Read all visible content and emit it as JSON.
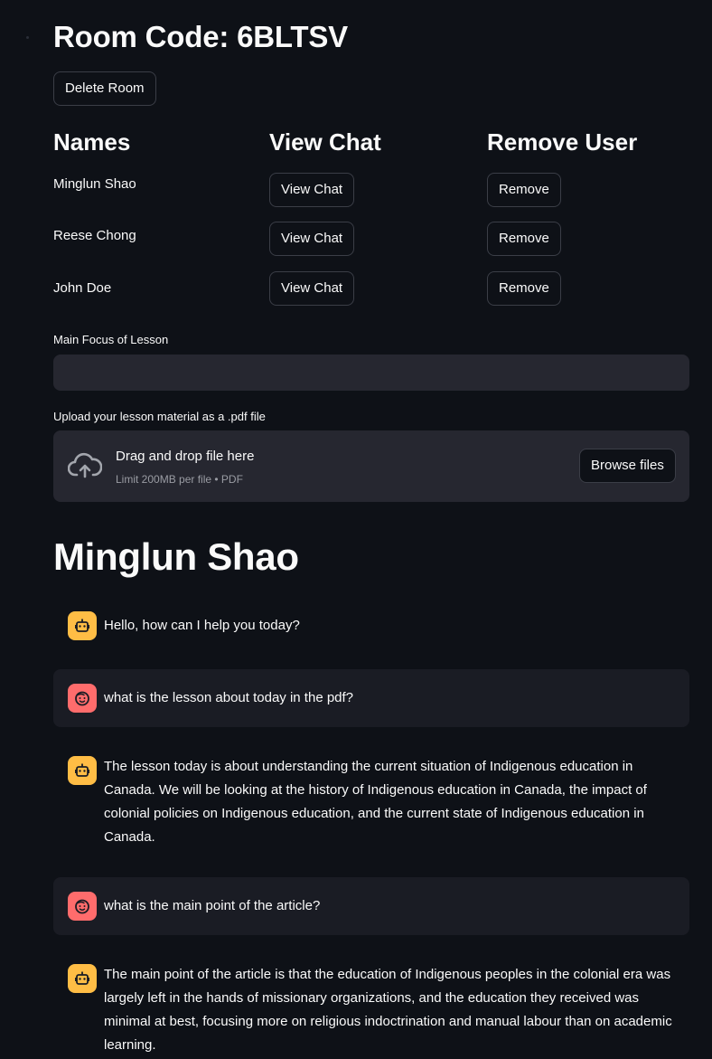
{
  "room": {
    "title": "Room Code: 6BLTSV",
    "delete_label": "Delete Room"
  },
  "table": {
    "headers": [
      "Names",
      "View Chat",
      "Remove User"
    ],
    "users": [
      {
        "name": "Minglun Shao",
        "view_label": "View Chat",
        "remove_label": "Remove"
      },
      {
        "name": "Reese Chong",
        "view_label": "View Chat",
        "remove_label": "Remove"
      },
      {
        "name": "John Doe",
        "view_label": "View Chat",
        "remove_label": "Remove"
      }
    ]
  },
  "focus": {
    "label": "Main Focus of Lesson",
    "value": ""
  },
  "upload": {
    "label": "Upload your lesson material as a .pdf file",
    "drop_text": "Drag and drop file here",
    "limit_text": "Limit 200MB per file • PDF",
    "browse_label": "Browse files"
  },
  "chat": {
    "title": "Minglun Shao",
    "messages": [
      {
        "role": "assistant",
        "avatar": "robot-icon",
        "text": "Hello, how can I help you today?"
      },
      {
        "role": "user",
        "avatar": "smiley-icon",
        "text": "what is the lesson about today in the pdf?"
      },
      {
        "role": "assistant",
        "avatar": "robot-icon",
        "text": "The lesson today is about understanding the current situation of Indigenous education in Canada. We will be looking at the history of Indigenous education in Canada, the impact of colonial policies on Indigenous education, and the current state of Indigenous education in Canada."
      },
      {
        "role": "user",
        "avatar": "smiley-icon",
        "text": "what is the main point of the article?"
      },
      {
        "role": "assistant",
        "avatar": "robot-icon",
        "text": "The main point of the article is that the education of Indigenous peoples in the colonial era was largely left in the hands of missionary organizations, and the education they received was minimal at best, focusing more on religious indoctrination and manual labour than on academic learning."
      }
    ]
  },
  "colors": {
    "background": "#0e1117",
    "input_bg": "#262730",
    "bot_avatar": "#ffbd45",
    "user_avatar": "#ff6c6c"
  }
}
